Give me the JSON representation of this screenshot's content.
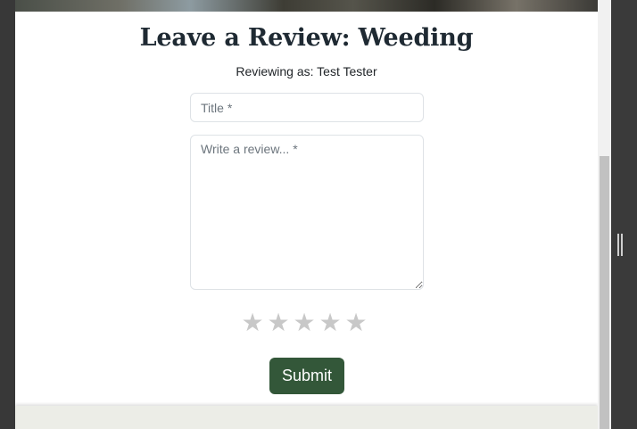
{
  "page": {
    "title": "Leave a Review: Weeding",
    "reviewing_as": "Reviewing as: Test Tester"
  },
  "form": {
    "title_placeholder": "Title *",
    "title_value": "",
    "review_placeholder": "Write a review... *",
    "review_value": "",
    "rating": {
      "value": 0,
      "max": 5,
      "glyph": "★",
      "empty_color": "#c8c8c8"
    },
    "submit_label": "Submit",
    "submit_color": "#335739"
  },
  "icons": {
    "star": "star-icon",
    "splitter_grip": "vertical-grip-icon"
  }
}
